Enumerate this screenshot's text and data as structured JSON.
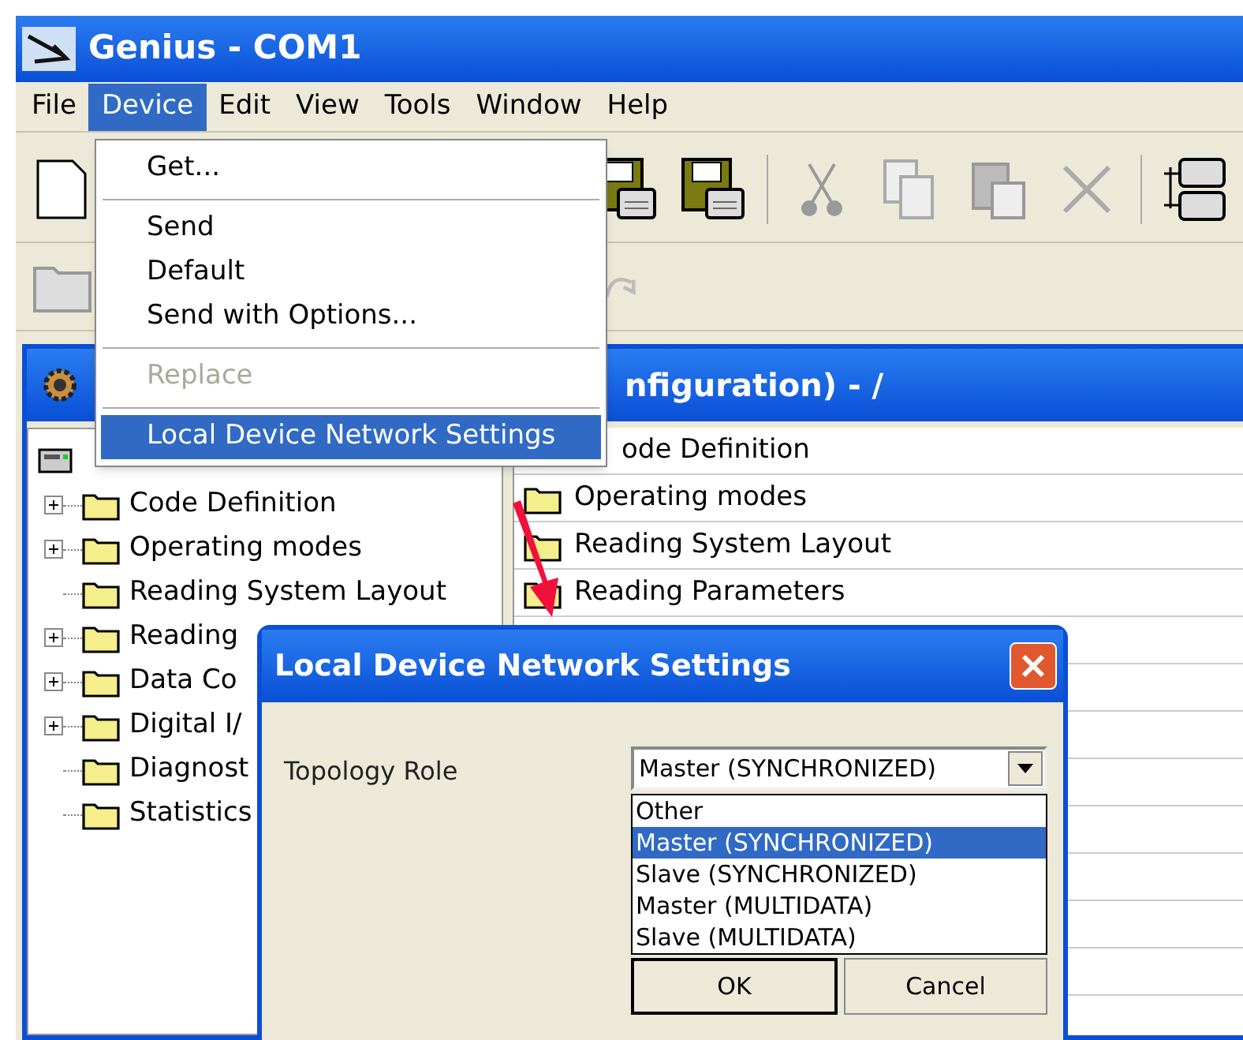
{
  "window": {
    "title": "Genius - COM1"
  },
  "menu_bar": [
    {
      "label": "File",
      "selected": false
    },
    {
      "label": "Device",
      "selected": true
    },
    {
      "label": "Edit",
      "selected": false
    },
    {
      "label": "View",
      "selected": false
    },
    {
      "label": "Tools",
      "selected": false
    },
    {
      "label": "Window",
      "selected": false
    },
    {
      "label": "Help",
      "selected": false
    }
  ],
  "device_menu": [
    {
      "kind": "item",
      "label": "Get...",
      "disabled": false,
      "selected": false
    },
    {
      "kind": "separator"
    },
    {
      "kind": "item",
      "label": "Send",
      "disabled": false,
      "selected": false
    },
    {
      "kind": "item",
      "label": "Default",
      "disabled": false,
      "selected": false
    },
    {
      "kind": "item",
      "label": "Send with Options...",
      "disabled": false,
      "selected": false
    },
    {
      "kind": "separator"
    },
    {
      "kind": "item",
      "label": "Replace",
      "disabled": true,
      "selected": false
    },
    {
      "kind": "separator"
    },
    {
      "kind": "item",
      "label": "Local Device Network Settings",
      "disabled": false,
      "selected": true
    }
  ],
  "child_window": {
    "title": "nfiguration) - /"
  },
  "tree": [
    {
      "label": "Code Definition",
      "expandable": true
    },
    {
      "label": "Operating modes",
      "expandable": true
    },
    {
      "label": "Reading System Layout",
      "expandable": false
    },
    {
      "label": "Reading",
      "expandable": true
    },
    {
      "label": "Data Co",
      "expandable": true
    },
    {
      "label": "Digital I/",
      "expandable": true
    },
    {
      "label": "Diagnost",
      "expandable": false
    },
    {
      "label": "Statistics",
      "expandable": false
    }
  ],
  "list": [
    {
      "label": "ode Definition",
      "icon": false
    },
    {
      "label": "Operating modes",
      "icon": true
    },
    {
      "label": "Reading System Layout",
      "icon": true
    },
    {
      "label": "Reading Parameters",
      "icon": true
    }
  ],
  "dialog": {
    "title": "Local Device Network Settings",
    "field_label": "Topology Role",
    "value": "Master (SYNCHRONIZED)",
    "options": [
      {
        "label": "Other",
        "selected": false
      },
      {
        "label": "Master (SYNCHRONIZED)",
        "selected": true
      },
      {
        "label": "Slave (SYNCHRONIZED)",
        "selected": false
      },
      {
        "label": "Master (MULTIDATA)",
        "selected": false
      },
      {
        "label": "Slave (MULTIDATA)",
        "selected": false
      }
    ],
    "buttons": [
      {
        "label": "OK",
        "default": true
      },
      {
        "label": "Cancel",
        "default": false
      }
    ]
  }
}
